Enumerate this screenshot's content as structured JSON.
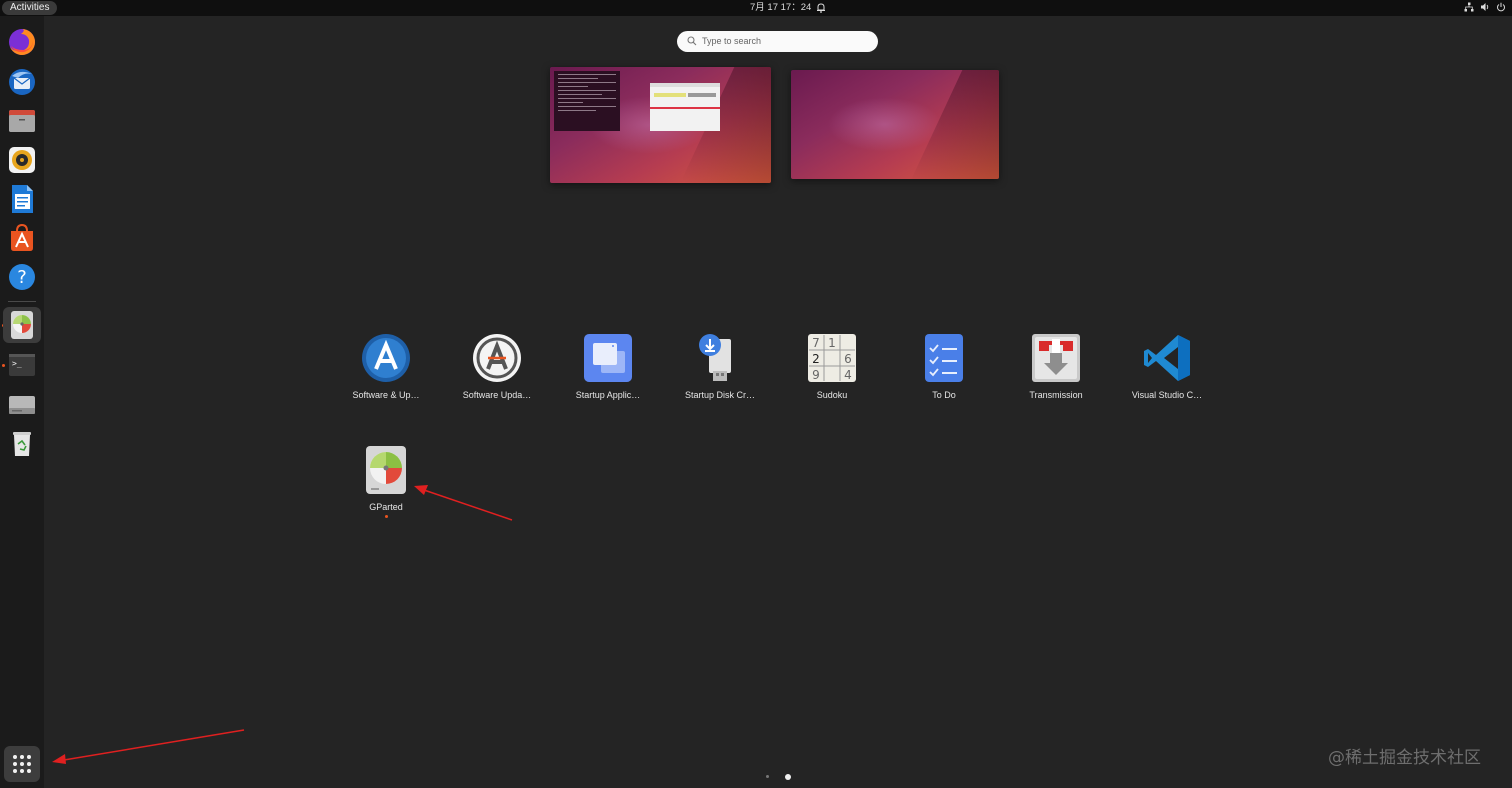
{
  "topbar": {
    "activities_label": "Activities",
    "clock": "7月 17  17：24",
    "tray_icons": [
      "network-icon",
      "volume-icon",
      "power-icon"
    ]
  },
  "dock": {
    "items": [
      {
        "name": "firefox",
        "running": false
      },
      {
        "name": "thunderbird",
        "running": false
      },
      {
        "name": "files",
        "running": false
      },
      {
        "name": "rhythmbox",
        "running": false
      },
      {
        "name": "libreoffice-writer",
        "running": false
      },
      {
        "name": "ubuntu-software",
        "running": false
      },
      {
        "name": "help",
        "running": false
      },
      {
        "name": "gparted",
        "running": true,
        "active": true
      },
      {
        "name": "terminal",
        "running": true
      },
      {
        "name": "disk",
        "running": false
      },
      {
        "name": "trash",
        "running": false
      }
    ],
    "show_apps_icon": "grid-icon"
  },
  "search": {
    "placeholder": "Type to search"
  },
  "workspaces": [
    {
      "index": 1,
      "windows": [
        "terminal",
        "gparted"
      ]
    },
    {
      "index": 2,
      "windows": []
    }
  ],
  "apps": {
    "row1": [
      {
        "label": "Software & Up…",
        "icon": "software-properties-icon"
      },
      {
        "label": "Software Upda…",
        "icon": "software-updater-icon"
      },
      {
        "label": "Startup Applic…",
        "icon": "startup-apps-icon"
      },
      {
        "label": "Startup Disk Cr…",
        "icon": "usb-creator-icon"
      },
      {
        "label": "Sudoku",
        "icon": "sudoku-icon"
      },
      {
        "label": "To Do",
        "icon": "todo-icon"
      },
      {
        "label": "Transmission",
        "icon": "transmission-icon"
      },
      {
        "label": "Visual Studio C…",
        "icon": "vscode-icon"
      }
    ],
    "row2": [
      {
        "label": "GParted",
        "icon": "gparted-icon",
        "running": true
      }
    ]
  },
  "sudoku_digits": [
    "7",
    "1",
    "2",
    "6",
    "9",
    "4"
  ],
  "pagination": {
    "pages": 2,
    "current": 2
  },
  "watermark": "@稀土掘金技术社区",
  "colors": {
    "accent": "#e95420",
    "annotation_arrow": "#e02020",
    "background": "#242424"
  }
}
